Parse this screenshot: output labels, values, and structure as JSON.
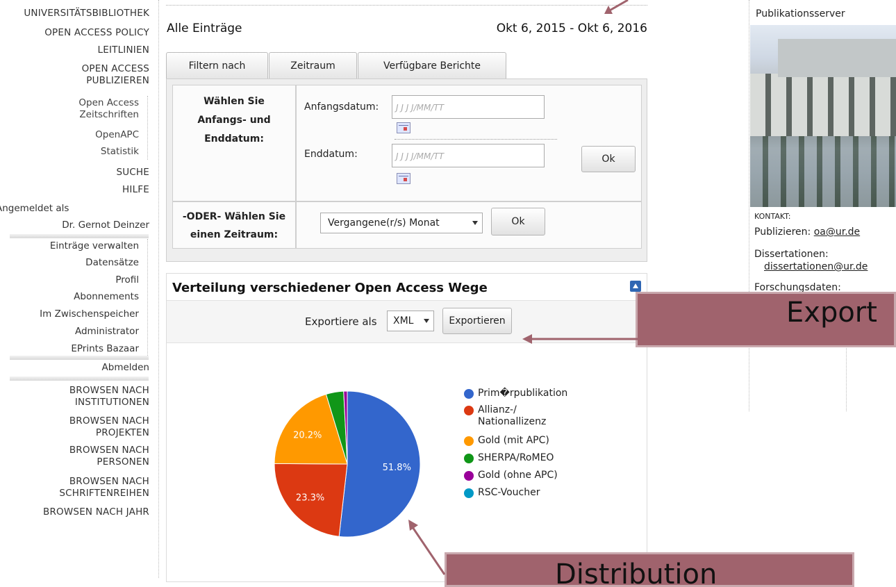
{
  "nav": {
    "items": [
      "UNIVERSITÄTSBIBLIOTHEK",
      "OPEN ACCESS POLICY",
      "LEITLINIEN",
      "OPEN ACCESS",
      "PUBLIZIEREN",
      "Open Access",
      "Zeitschriften",
      "OpenAPC",
      "Statistik",
      "SUCHE",
      "HILFE"
    ],
    "logged_in_label": "Angemeldet als",
    "user_name": "Dr. Gernot Deinzer",
    "user_menu": [
      "Einträge verwalten",
      "Datensätze",
      "Profil",
      "Abonnements",
      "Im Zwischenspeicher",
      "Administrator",
      "EPrints Bazaar"
    ],
    "logout": "Abmelden",
    "browse": [
      "BROWSEN NACH",
      "INSTITUTIONEN",
      "BROWSEN NACH",
      "PROJEKTEN",
      "BROWSEN NACH",
      "PERSONEN",
      "BROWSEN NACH",
      "SCHRIFTENREIHEN",
      "BROWSEN NACH JAHR"
    ]
  },
  "main": {
    "title": "Alle Einträge",
    "date_range": "Okt 6, 2015 - Okt 6, 2016",
    "tabs": [
      "Filtern nach",
      "Zeitraum",
      "Verfügbare Berichte"
    ],
    "filter": {
      "choose_dates_label": [
        "Wählen Sie",
        "Anfangs- und",
        "Enddatum:"
      ],
      "start_label": "Anfangsdatum:",
      "end_label": "Enddatum:",
      "date_placeholder": "J J J J/MM/TT",
      "ok": "Ok",
      "or_label": [
        "-ODER- Wählen Sie",
        "einen Zeitraum:"
      ],
      "period_selected": "Vergangene(r/s) Monat",
      "ok2": "Ok"
    },
    "panel": {
      "title": "Verteilung verschiedener Open Access Wege",
      "export_label": "Exportiere als",
      "export_format": "XML",
      "export_button": "Exportieren"
    }
  },
  "chart_data": {
    "type": "pie",
    "series": [
      {
        "name": "Prim�rpublikation",
        "value": 51.8,
        "color": "#3366cc",
        "label": "51.8%"
      },
      {
        "name": "Allianz-/ Nationallizenz",
        "value": 23.3,
        "color": "#dc3912",
        "label": "23.3%"
      },
      {
        "name": "Gold (mit APC)",
        "value": 20.2,
        "color": "#ff9900",
        "label": "20.2%"
      },
      {
        "name": "SHERPA/RoMEO",
        "value": 3.9,
        "color": "#109618",
        "label": ""
      },
      {
        "name": "Gold (ohne APC)",
        "value": 0.8,
        "color": "#990099",
        "label": ""
      },
      {
        "name": "RSC-Voucher",
        "value": 0.0,
        "color": "#0099c6",
        "label": ""
      }
    ],
    "legend_lines": [
      "Prim�rpublikation",
      "Allianz-/",
      "Nationallizenz",
      "Gold (mit APC)",
      "SHERPA/RoMEO",
      "Gold (ohne APC)",
      "RSC-Voucher"
    ],
    "legend_position": "right"
  },
  "right": {
    "title": "Publikationsserver",
    "kontakt": "KONTAKT:",
    "publizieren_label": "Publizieren:",
    "publizieren_email": "oa@ur.de",
    "diss_label": "Dissertationen:",
    "diss_email": "dissertationen@ur.de",
    "forsch_label": "Forschungsdaten:"
  },
  "annotations": {
    "export": "Export",
    "distribution": "Distribution"
  }
}
